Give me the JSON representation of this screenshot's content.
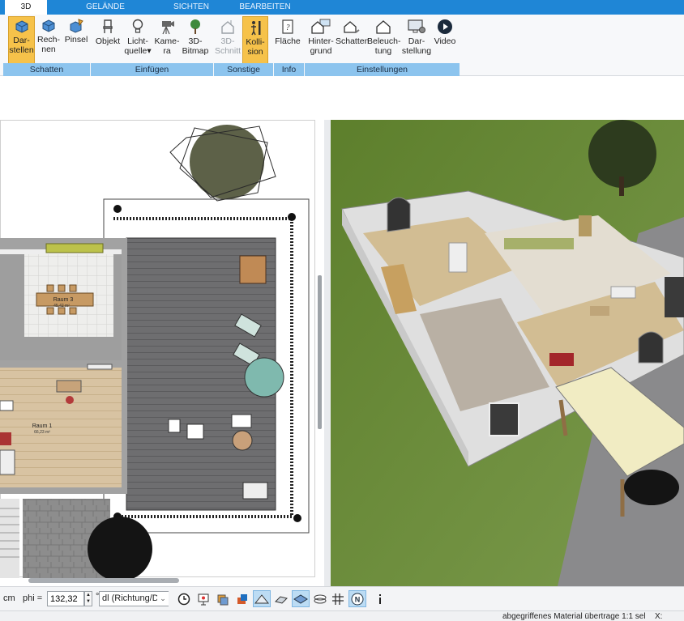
{
  "tabs": [
    "3D",
    "GELÄNDE",
    "SICHTEN",
    "BEARBEITEN"
  ],
  "ribbon": {
    "buttons": [
      {
        "l1": "Dar-",
        "l2": "stellen"
      },
      {
        "l1": "Rech-",
        "l2": "nen"
      },
      {
        "l1": "Pinsel",
        "l2": ""
      },
      {
        "l1": "Objekt",
        "l2": ""
      },
      {
        "l1": "Licht-",
        "l2": "quelle"
      },
      {
        "l1": "Kame-",
        "l2": "ra"
      },
      {
        "l1": "3D-",
        "l2": "Bitmap"
      },
      {
        "l1": "3D-",
        "l2": "Schnitt"
      },
      {
        "l1": "Kolli-",
        "l2": "sion"
      },
      {
        "l1": "Fläche",
        "l2": ""
      },
      {
        "l1": "Hinter-",
        "l2": "grund"
      },
      {
        "l1": "Schatten",
        "l2": ""
      },
      {
        "l1": "Beleuch-",
        "l2": "tung"
      },
      {
        "l1": "Dar-",
        "l2": "stellung"
      },
      {
        "l1": "Video",
        "l2": ""
      }
    ],
    "groups": [
      "Schatten",
      "Einfügen",
      "Sonstige",
      "Info",
      "Einstellungen"
    ]
  },
  "plan": {
    "room1_name": "Raum 1",
    "room1_area": "66,23 m²",
    "room3_name": "Raum 3",
    "room3_area": "45,42 m²"
  },
  "toolbar": {
    "unit": "cm",
    "phi_label": "phi =",
    "phi_value": "132,32",
    "degree": "°",
    "direction_select": "dl (Richtung/Di"
  },
  "status": {
    "message": "abgegriffenes Material übertrage 1:1 sel",
    "x_label": "X:"
  },
  "colors": {
    "ribbon_blue": "#1f86d6",
    "group_blue": "#8cc4ee",
    "active_orange": "#f6c24a",
    "grass": "#6f8f3a"
  }
}
